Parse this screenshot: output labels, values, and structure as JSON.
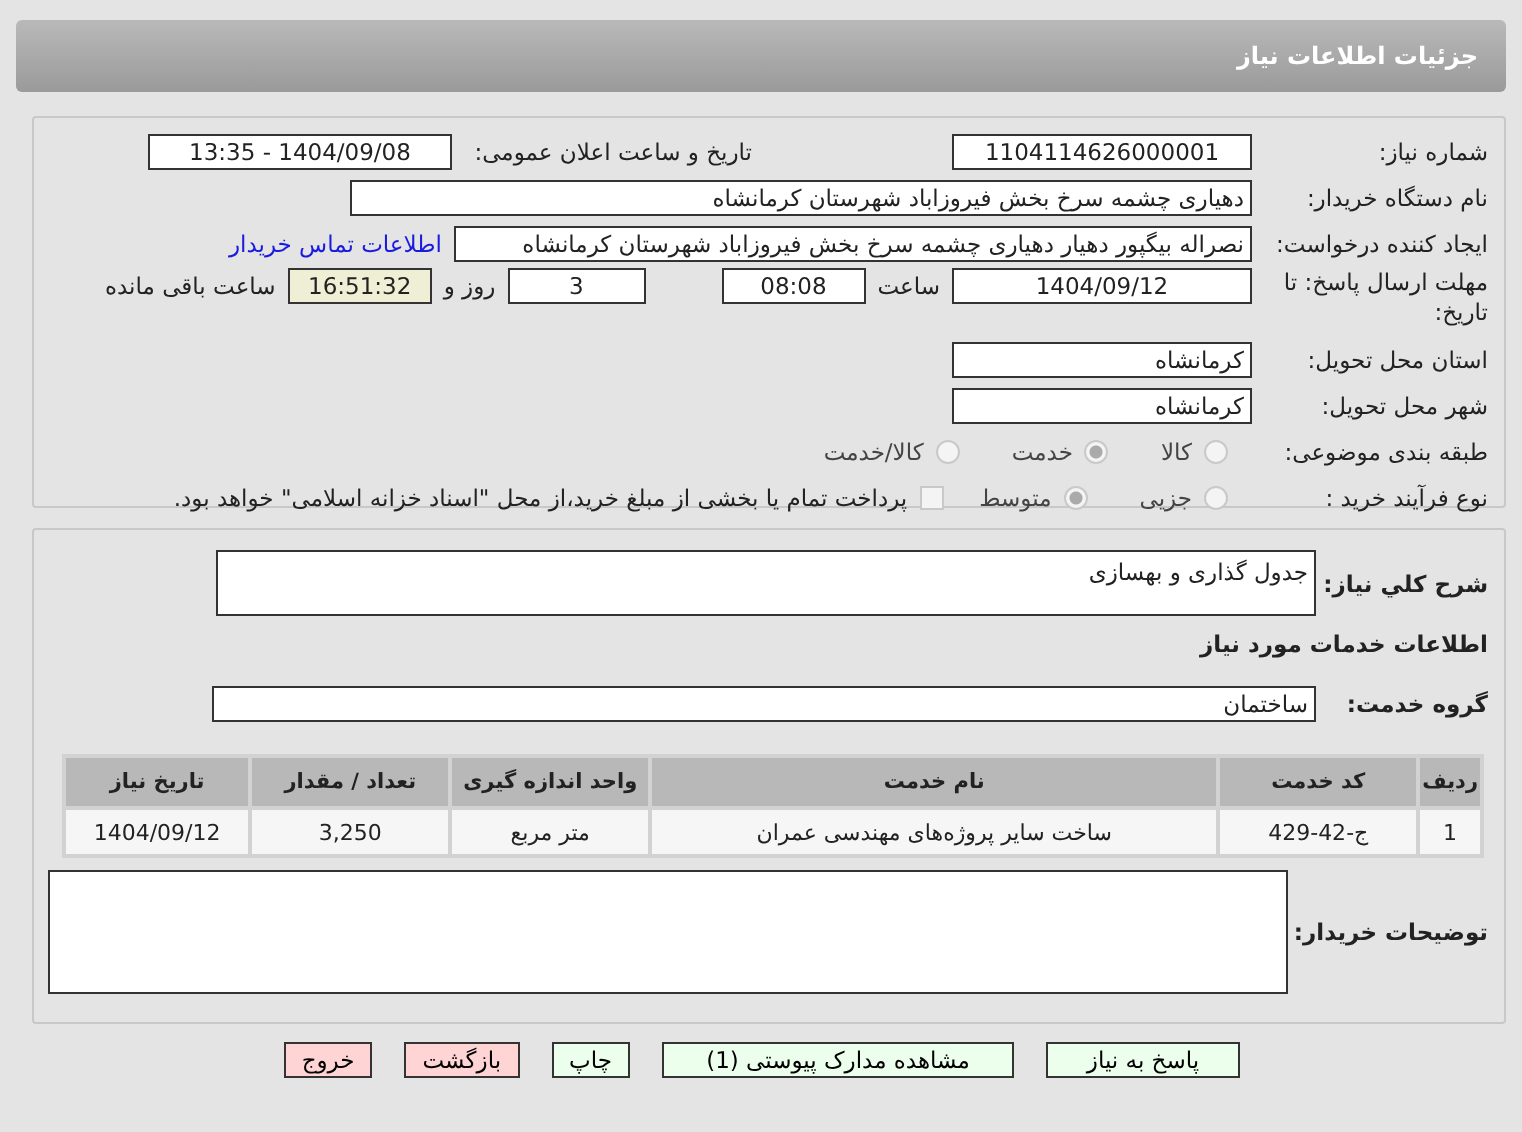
{
  "header": {
    "title": "جزئیات اطلاعات نیاز"
  },
  "need_number": {
    "label": "شماره نیاز:",
    "value": "1104114626000001"
  },
  "announce": {
    "label": "تاریخ و ساعت اعلان عمومی:",
    "value": "1404/09/08 - 13:35"
  },
  "buyer": {
    "label": "نام دستگاه خریدار:",
    "value": "دهیاری چشمه سرخ بخش فیروزاباد شهرستان کرمانشاه"
  },
  "creator": {
    "label": "ایجاد کننده درخواست:",
    "value": "نصراله بیگپور دهیار دهیاری چشمه سرخ بخش فیروزاباد شهرستان کرمانشاه",
    "link": "اطلاعات تماس خریدار"
  },
  "deadline": {
    "label": "مهلت ارسال پاسخ: تا تاریخ:",
    "date": "1404/09/12",
    "time_label": "ساعت",
    "time": "08:08",
    "days": "3",
    "days_label": "روز و",
    "remaining": "16:51:32",
    "remaining_label": "ساعت باقی مانده"
  },
  "province": {
    "label": "استان محل تحویل:",
    "value": "کرمانشاه"
  },
  "city": {
    "label": "شهر محل تحویل:",
    "value": "کرمانشاه"
  },
  "category": {
    "label": "طبقه بندی موضوعی:",
    "options": [
      {
        "label": "کالا",
        "selected": false
      },
      {
        "label": "خدمت",
        "selected": true
      },
      {
        "label": "کالا/خدمت",
        "selected": false
      }
    ]
  },
  "purchase_type": {
    "label": "نوع فرآیند خرید :",
    "options": [
      {
        "label": "جزیی",
        "selected": false
      },
      {
        "label": "متوسط",
        "selected": true
      }
    ],
    "treasury": {
      "checked": false,
      "text": "پرداخت تمام یا بخشی از مبلغ خرید،از محل \"اسناد خزانه اسلامی\" خواهد بود."
    }
  },
  "description": {
    "label": "شرح کلي نياز:",
    "value": "جدول گذاری و بهسازی"
  },
  "services_heading": "اطلاعات خدمات مورد نیاز",
  "service_group": {
    "label": "گروه خدمت:",
    "value": "ساختمان"
  },
  "table": {
    "columns": [
      "ردیف",
      "کد خدمت",
      "نام خدمت",
      "واحد اندازه گیری",
      "تعداد / مقدار",
      "تاریخ نیاز"
    ],
    "rows": [
      [
        "1",
        "ج-42-429",
        "ساخت سایر پروژه‌های مهندسی عمران",
        "متر مربع",
        "3,250",
        "1404/09/12"
      ]
    ]
  },
  "buyer_notes": {
    "label": "توضیحات خریدار:"
  },
  "buttons": [
    {
      "label": "پاسخ به نیاز",
      "kind": "primary"
    },
    {
      "label": "مشاهده مدارک پیوستی (1)",
      "kind": "primary"
    },
    {
      "label": "چاپ",
      "kind": "primary"
    },
    {
      "label": "بازگشت",
      "kind": "danger"
    },
    {
      "label": "خروج",
      "kind": "danger"
    }
  ]
}
